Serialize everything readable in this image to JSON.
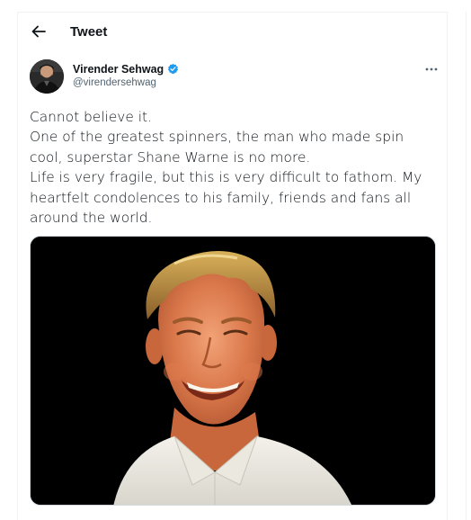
{
  "header": {
    "title": "Tweet"
  },
  "author": {
    "name": "Virender Sehwag",
    "handle": "@virendersehwag",
    "verified": true
  },
  "tweet": {
    "lines": [
      "Cannot believe it.",
      "One of the greatest spinners, the man who made spin",
      "cool, superstar Shane Warne is no more.",
      "Life is very fragile, but this is very difficult to fathom. My",
      "heartfelt condolences to his family, friends and fans all",
      "around the world."
    ]
  },
  "icons": {
    "back": "arrow-left-icon",
    "more": "more-horizontal-icon",
    "verified": "verified-badge-icon"
  },
  "colors": {
    "verified_blue": "#1d9bf0",
    "text_primary": "#0f1419",
    "text_secondary": "#536471",
    "border": "#eff3f4"
  }
}
